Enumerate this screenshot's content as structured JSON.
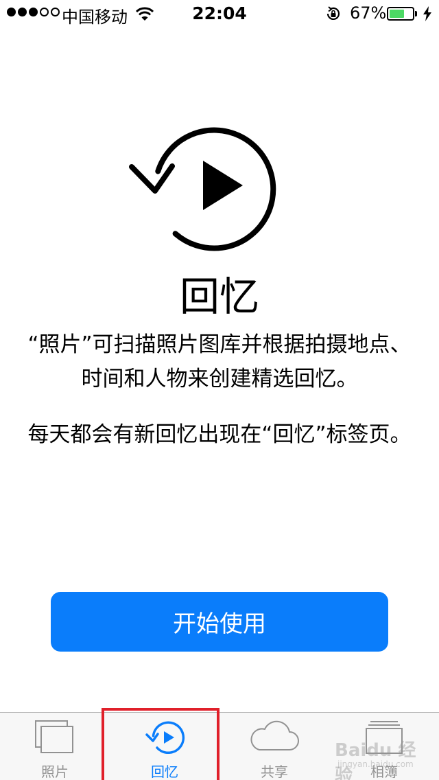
{
  "status_bar": {
    "carrier": "中国移动",
    "time": "22:04",
    "battery_percent": "67%",
    "battery_level": 0.67,
    "signal_bars_filled": 3,
    "signal_bars_total": 5,
    "icons": [
      "wifi-icon",
      "rotation-lock-icon",
      "battery-icon",
      "charging-icon"
    ]
  },
  "main": {
    "hero_icon": "memories-play-icon",
    "title": "回忆",
    "description_lines": [
      "“照片”可扫描照片图库并根据拍摄地点、时间和人物来创建精选回忆。",
      "每天都会有新回忆出现在“回忆”标签页。"
    ],
    "start_button": "开始使用"
  },
  "tab_bar": {
    "tabs": [
      {
        "label": "照片",
        "icon": "photos-icon",
        "active": false
      },
      {
        "label": "回忆",
        "icon": "memories-icon",
        "active": true
      },
      {
        "label": "共享",
        "icon": "cloud-icon",
        "active": false
      },
      {
        "label": "相簿",
        "icon": "albums-icon",
        "active": false
      }
    ]
  },
  "colors": {
    "accent": "#0a7dfb",
    "inactive_tab": "#929292",
    "battery": "#4cd964",
    "highlight": "#e0202a"
  },
  "watermark": {
    "text": "Baidu 经验",
    "sub": "jingyan.baidu.com"
  }
}
